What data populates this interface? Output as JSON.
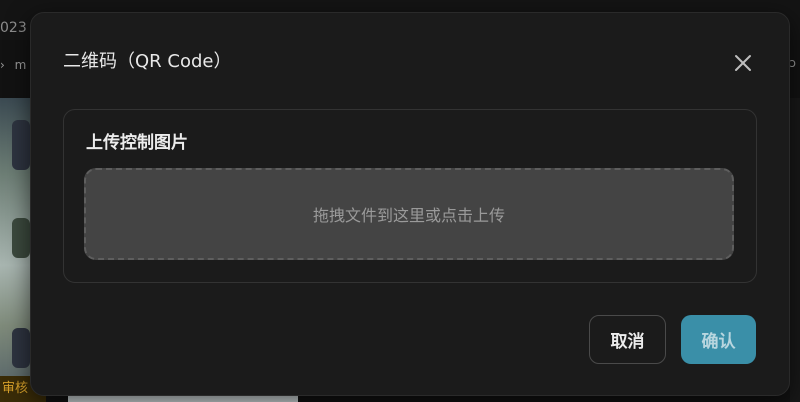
{
  "background": {
    "year_fragment": "023",
    "row_fragment": [
      "›",
      "m"
    ],
    "right_fragment": "ɑɔ",
    "badge_label": "审核"
  },
  "dialog": {
    "title": "二维码（QR Code）",
    "close_icon": "close-icon",
    "section_title": "上传控制图片",
    "dropzone_text": "拖拽文件到这里或点击上传",
    "cancel_label": "取消",
    "confirm_label": "确认"
  },
  "colors": {
    "dialog_bg": "#1b1b1b",
    "dropzone_bg": "#444444",
    "confirm_bg": "#3a8fa8",
    "badge_text": "#d7a12a"
  }
}
